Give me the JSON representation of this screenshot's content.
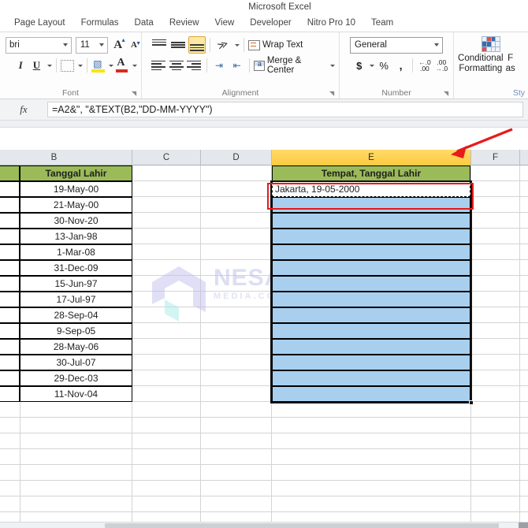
{
  "window": {
    "title": "Microsoft Excel"
  },
  "ribbon": {
    "tabs": [
      {
        "label": "Page Layout"
      },
      {
        "label": "Formulas"
      },
      {
        "label": "Data"
      },
      {
        "label": "Review"
      },
      {
        "label": "View"
      },
      {
        "label": "Developer"
      },
      {
        "label": "Nitro Pro 10"
      },
      {
        "label": "Team"
      }
    ],
    "font_group": {
      "label": "Font",
      "font_name": "bri",
      "font_size": "11"
    },
    "alignment_group": {
      "label": "Alignment",
      "wrap_text": "Wrap Text",
      "merge_center": "Merge & Center"
    },
    "number_group": {
      "label": "Number",
      "format": "General",
      "currency": "$",
      "percent": "%",
      "comma": ","
    },
    "styles_group": {
      "label": "Sty",
      "conditional_line1": "Conditional",
      "conditional_line2": "Formatting",
      "format_as_line1": "F",
      "format_as_line2": "as"
    }
  },
  "formula_bar": {
    "fx_label": "fx",
    "formula": "=A2&\", \"&TEXT(B2,\"DD-MM-YYYY\")"
  },
  "sheet": {
    "columns": [
      {
        "label": "B",
        "active": false
      },
      {
        "label": "C",
        "active": false
      },
      {
        "label": "D",
        "active": false
      },
      {
        "label": "E",
        "active": true
      },
      {
        "label": "F",
        "active": false
      }
    ],
    "column_b": {
      "header": "Tanggal Lahir",
      "values": [
        "19-May-00",
        "21-May-00",
        "30-Nov-20",
        "13-Jan-98",
        "1-Mar-08",
        "31-Dec-09",
        "15-Jun-97",
        "17-Jul-97",
        "28-Sep-04",
        "9-Sep-05",
        "28-May-06",
        "30-Jul-07",
        "29-Dec-03",
        "11-Nov-04"
      ]
    },
    "column_e": {
      "header": "Tempat, Tanggal Lahir",
      "active_cell_value": "Jakarta, 19-05-2000",
      "empty_rows": 13
    }
  },
  "watermark": {
    "text": "NESABA",
    "subtext": "MEDIA.COM"
  },
  "colors": {
    "header_green": "#9bbb59",
    "selection_blue": "#a9cfee",
    "active_column_yellow": "#ffc93e",
    "annotation_red": "#e81a1a"
  }
}
